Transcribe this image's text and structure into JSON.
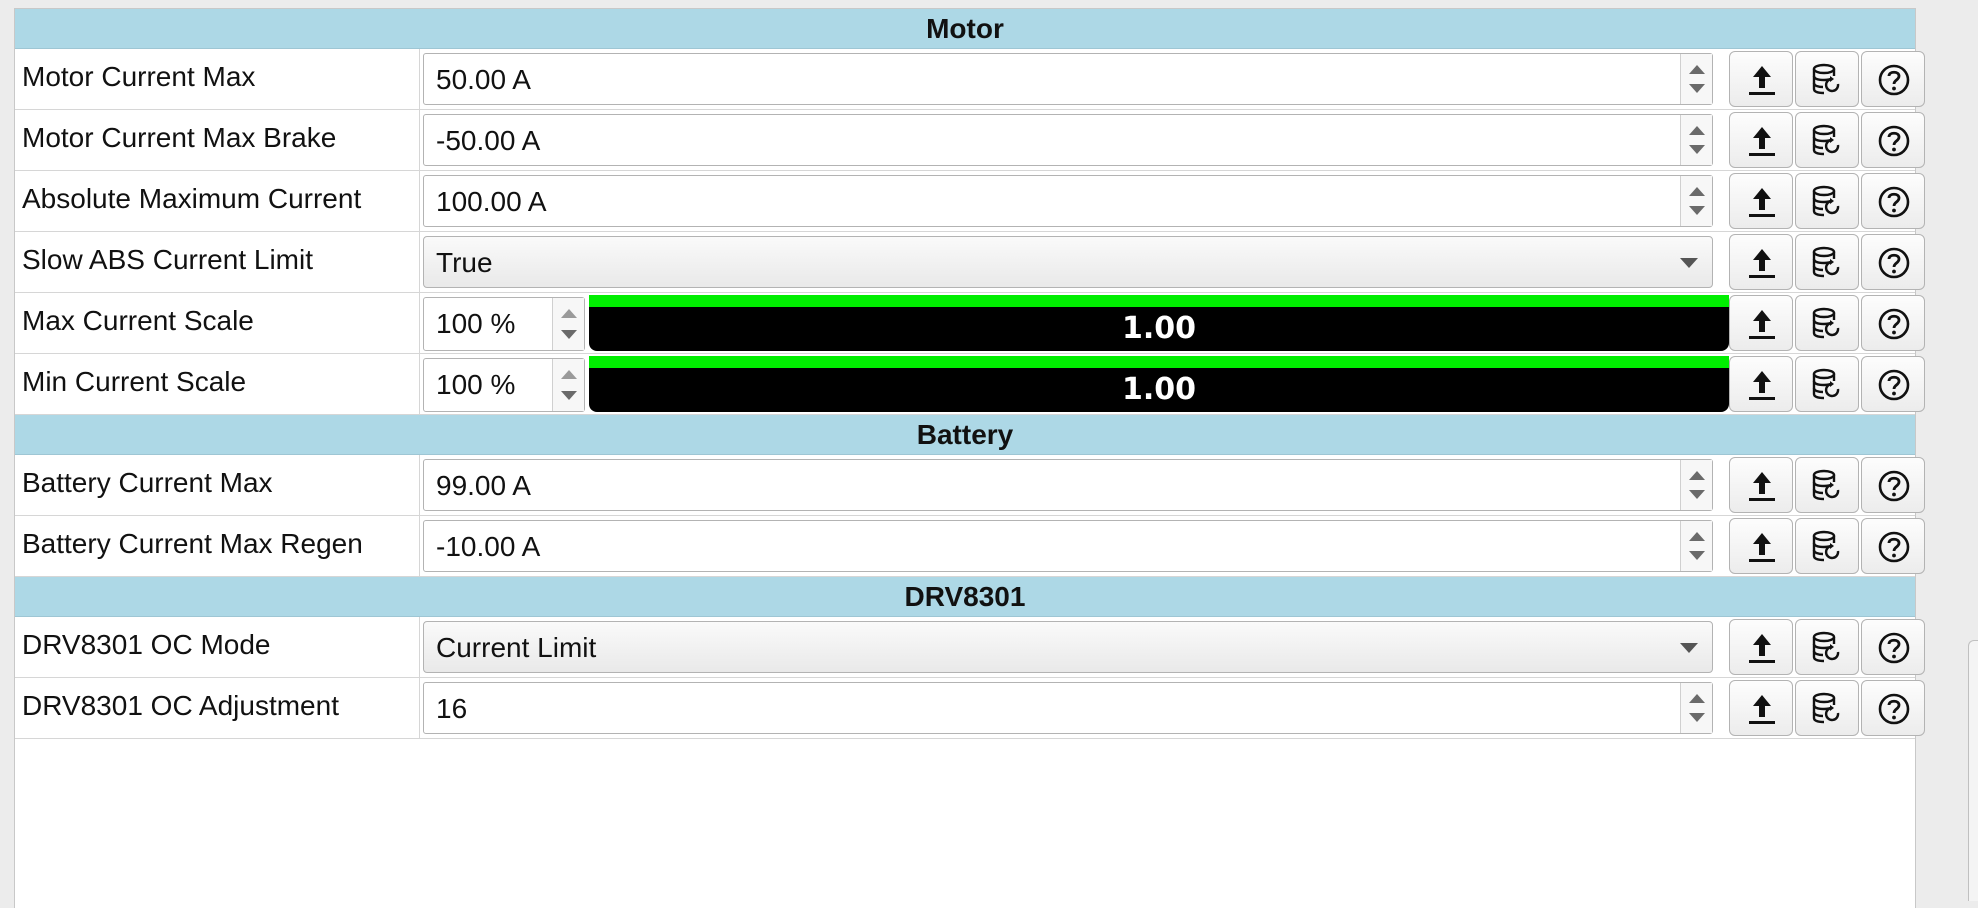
{
  "sections": [
    {
      "title": "Motor",
      "rows": [
        {
          "label": "Motor Current Max",
          "kind": "spin",
          "value": "50.00 A"
        },
        {
          "label": "Motor Current Max Brake",
          "kind": "spin",
          "value": "-50.00 A"
        },
        {
          "label": "Absolute Maximum Current",
          "kind": "spin",
          "value": "100.00 A"
        },
        {
          "label": "Slow ABS Current Limit",
          "kind": "combo",
          "value": "True"
        },
        {
          "label": "Max Current Scale",
          "kind": "scale",
          "value": "100 %",
          "readout": "1.00",
          "level": 1.0
        },
        {
          "label": "Min Current Scale",
          "kind": "scale",
          "value": "100 %",
          "readout": "1.00",
          "level": 1.0
        }
      ]
    },
    {
      "title": "Battery",
      "rows": [
        {
          "label": "Battery Current Max",
          "kind": "spin",
          "value": "99.00 A"
        },
        {
          "label": "Battery Current Max Regen",
          "kind": "spin",
          "value": "-10.00 A"
        }
      ]
    },
    {
      "title": "DRV8301",
      "rows": [
        {
          "label": "DRV8301 OC Mode",
          "kind": "combo",
          "value": "Current Limit"
        },
        {
          "label": "DRV8301 OC Adjustment",
          "kind": "spin",
          "value": "16"
        }
      ]
    }
  ],
  "row_buttons": {
    "upload_icon": "upload-arrow-icon",
    "restore_icon": "database-restore-icon",
    "help_icon": "help-question-icon"
  },
  "colors": {
    "section_header": "#add8e6",
    "scale_fill": "#00ee00",
    "scale_background": "#000000"
  }
}
